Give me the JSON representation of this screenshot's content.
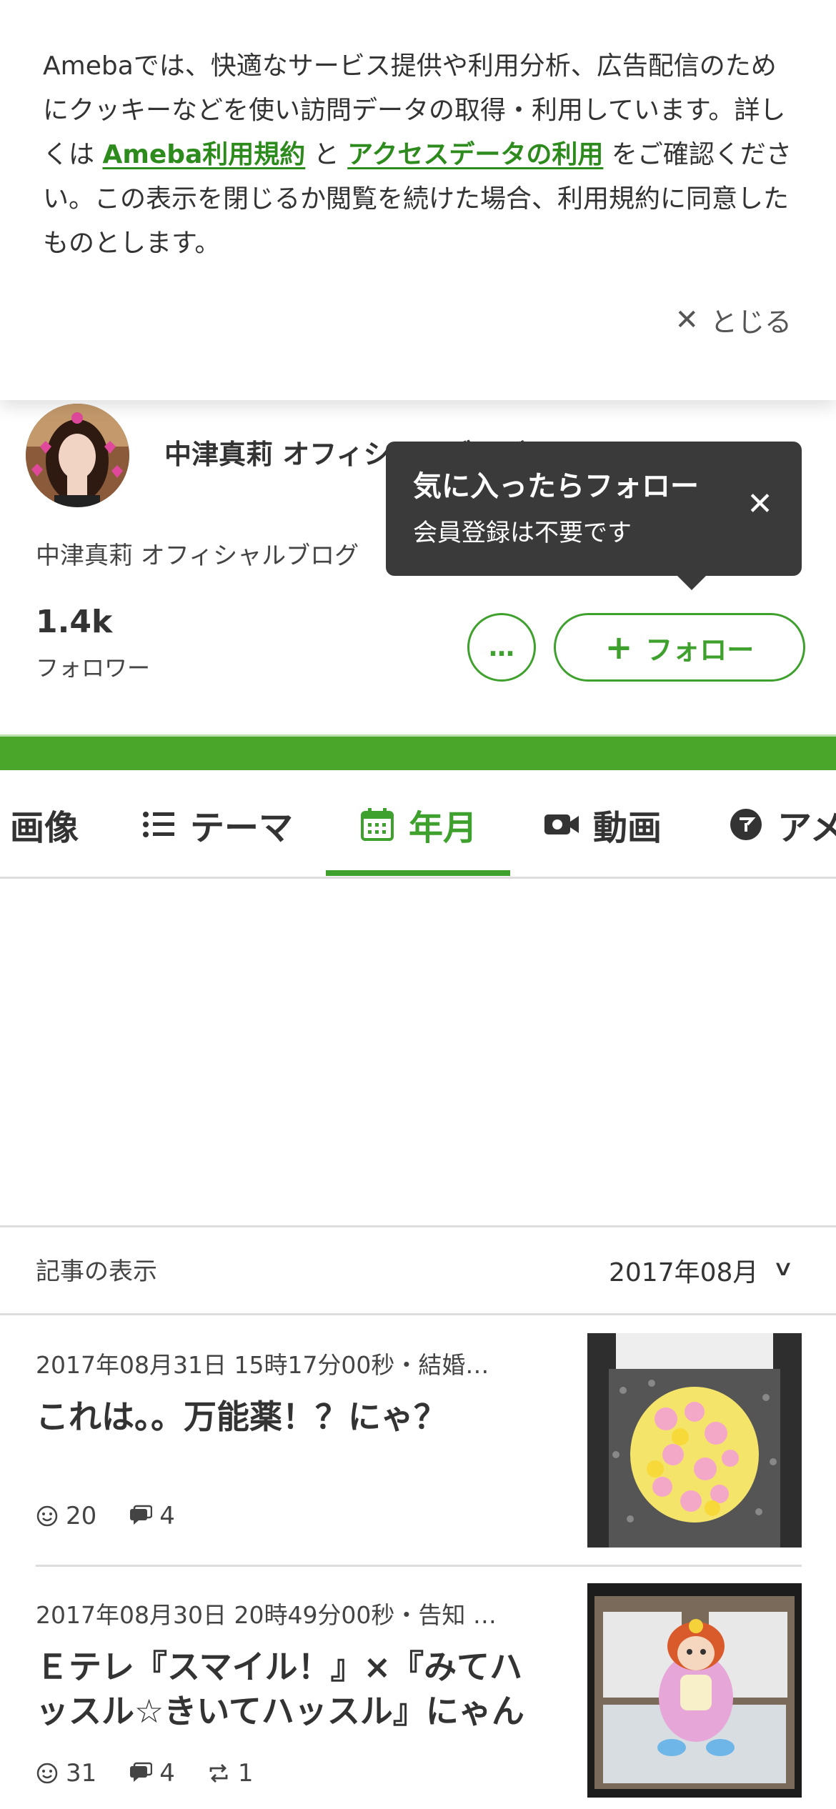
{
  "cookie_banner": {
    "text_before": "Amebaでは、快適なサービス提供や利用分析、広告配信のためにクッキーなどを使い訪問データの取得・利用しています。詳しくは ",
    "link_terms": "Ameba利用規約",
    "text_middle": " と ",
    "link_access": "アクセスデータの利用",
    "text_after": " をご確認ください。この表示を閉じるか閲覧を続けた場合、利用規約に同意したものとします。",
    "close_label": "とじる"
  },
  "profile": {
    "blog_title": "中津真莉 オフィシャルブログ",
    "blog_subtitle": "中津真莉 オフィシャルブログ",
    "followers_count": "1.4k",
    "followers_label": "フォロワー",
    "more_label": "…",
    "follow_label": "フォロー"
  },
  "tooltip": {
    "title": "気に入ったらフォロー",
    "subtitle": "会員登録は不要です"
  },
  "tabs": [
    {
      "label": "画像",
      "icon": "image-icon",
      "active": false
    },
    {
      "label": "テーマ",
      "icon": "list-icon",
      "active": false
    },
    {
      "label": "年月",
      "icon": "calendar-icon",
      "active": true
    },
    {
      "label": "動画",
      "icon": "video-icon",
      "active": false
    },
    {
      "label": "アメ",
      "icon": "ameba-icon",
      "active": false
    }
  ],
  "selector": {
    "label": "記事の表示",
    "value": "2017年08月"
  },
  "articles": [
    {
      "meta": "2017年08月31日 15時17分00秒・結婚…",
      "title": "これは。。万能薬！？にゃ？",
      "likes": "20",
      "comments": "4",
      "reblogs": ""
    },
    {
      "meta": "2017年08月30日 20時49分00秒・告知 …",
      "title": "Ｅテレ『スマイル！』×『みてハッスル☆きいてハッスル』にゃん",
      "likes": "31",
      "comments": "4",
      "reblogs": "1"
    }
  ],
  "colors": {
    "accent": "#3fa12d",
    "green_bar": "#4aa62b",
    "link": "#2d8a1c",
    "tooltip_bg": "#3a3a3a"
  }
}
